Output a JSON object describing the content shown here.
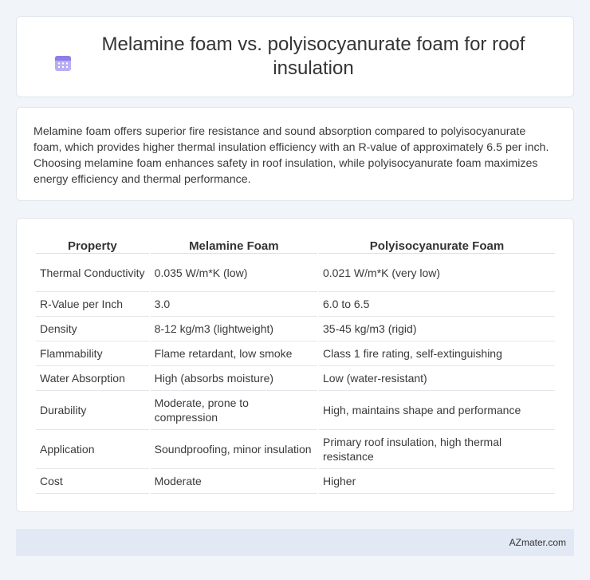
{
  "header": {
    "title": "Melamine foam vs. polyisocyanurate foam for roof insulation",
    "icon": "calendar-icon",
    "icon_color": "#8d7ee8"
  },
  "summary": {
    "text": "Melamine foam offers superior fire resistance and sound absorption compared to polyisocyanurate foam, which provides higher thermal insulation efficiency with an R-value of approximately 6.5 per inch. Choosing melamine foam enhances safety in roof insulation, while polyisocyanurate foam maximizes energy efficiency and thermal performance."
  },
  "table": {
    "headers": [
      "Property",
      "Melamine Foam",
      "Polyisocyanurate Foam"
    ],
    "rows": [
      [
        "Thermal Conductivity",
        "0.035 W/m*K (low)",
        "0.021 W/m*K (very low)"
      ],
      [
        "R-Value per Inch",
        "3.0",
        "6.0 to 6.5"
      ],
      [
        "Density",
        "8-12 kg/m3 (lightweight)",
        "35-45 kg/m3 (rigid)"
      ],
      [
        "Flammability",
        "Flame retardant, low smoke",
        "Class 1 fire rating, self-extinguishing"
      ],
      [
        "Water Absorption",
        "High (absorbs moisture)",
        "Low (water-resistant)"
      ],
      [
        "Durability",
        "Moderate, prone to compression",
        "High, maintains shape and performance"
      ],
      [
        "Application",
        "Soundproofing, minor insulation",
        "Primary roof insulation, high thermal resistance"
      ],
      [
        "Cost",
        "Moderate",
        "Higher"
      ]
    ]
  },
  "footer": {
    "brand": "AZmater.com"
  }
}
